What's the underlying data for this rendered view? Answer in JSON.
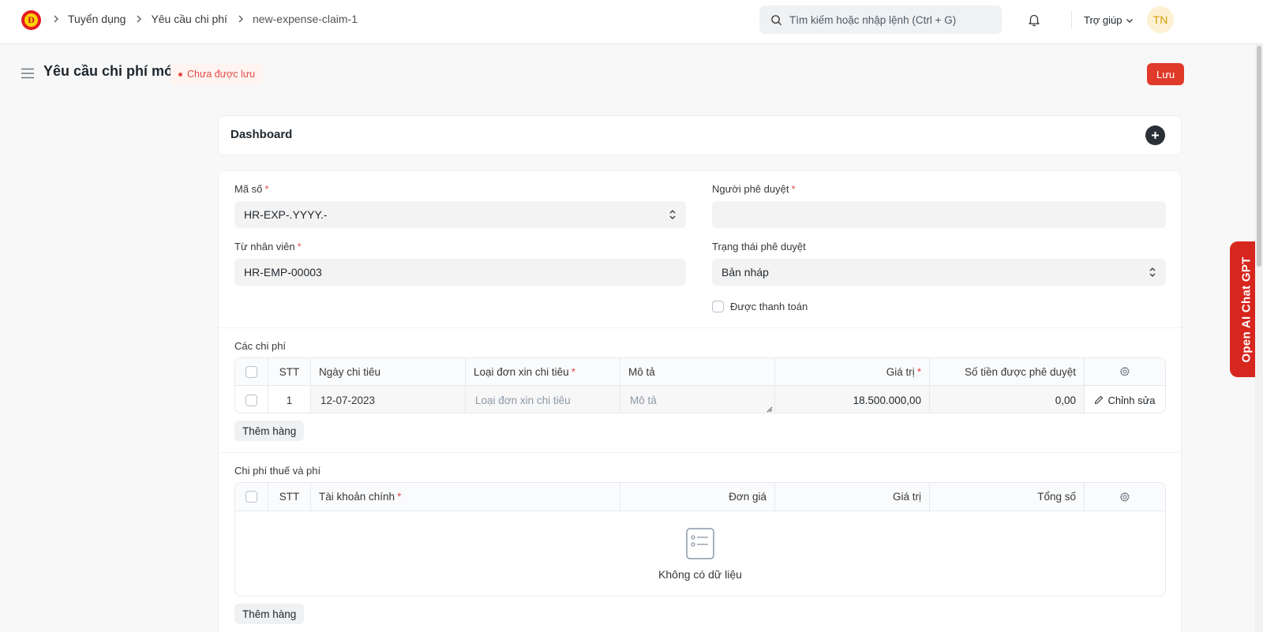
{
  "breadcrumb": {
    "items": [
      "Tuyển dụng",
      "Yêu cầu chi phí",
      "new-expense-claim-1"
    ]
  },
  "navbar": {
    "logo_letter": "Đ",
    "search_placeholder": "Tìm kiếm hoặc nhập lệnh (Ctrl + G)",
    "help_label": "Trợ giúp",
    "avatar_initials": "TN"
  },
  "page": {
    "title": "Yêu cầu chi phí mới",
    "status": "Chưa được lưu",
    "save_label": "Lưu"
  },
  "dashboard": {
    "title": "Dashboard"
  },
  "form": {
    "naming_series": {
      "label": "Mã số",
      "value": "HR-EXP-.YYYY.-"
    },
    "approver": {
      "label": "Người phê duyệt",
      "value": ""
    },
    "employee": {
      "label": "Từ nhân viên",
      "value": "HR-EMP-00003"
    },
    "approval_status": {
      "label": "Trạng thái phê duyệt",
      "value": "Bản nháp"
    },
    "is_paid": {
      "label": "Được thanh toán",
      "checked": false
    }
  },
  "expenses": {
    "label": "Các chi phí",
    "columns": [
      "STT",
      "Ngày chi tiêu",
      "Loại đơn xin chi tiêu",
      "Mô tả",
      "Giá trị",
      "Số tiền được phê duyệt"
    ],
    "rows": [
      {
        "idx": "1",
        "date": "12-07-2023",
        "type_placeholder": "Loại đơn xin chi tiêu",
        "desc_placeholder": "Mô tả",
        "amount": "18.500.000,00",
        "sanctioned": "0,00",
        "edit_label": "Chỉnh sửa"
      }
    ],
    "add_row_label": "Thêm hàng"
  },
  "taxes": {
    "label": "Chi phí thuế và phí",
    "columns": [
      "STT",
      "Tài khoản chính",
      "Đơn giá",
      "Giá trị",
      "Tổng số"
    ],
    "empty_text": "Không có dữ liệu",
    "add_row_label": "Thêm hàng"
  },
  "sidebar_tab": {
    "label": "Open AI Chat GPT"
  },
  "colors": {
    "primary_red": "#e03a2a",
    "indicator_red": "#e24c4c",
    "gpt_tab": "#d7261e"
  }
}
